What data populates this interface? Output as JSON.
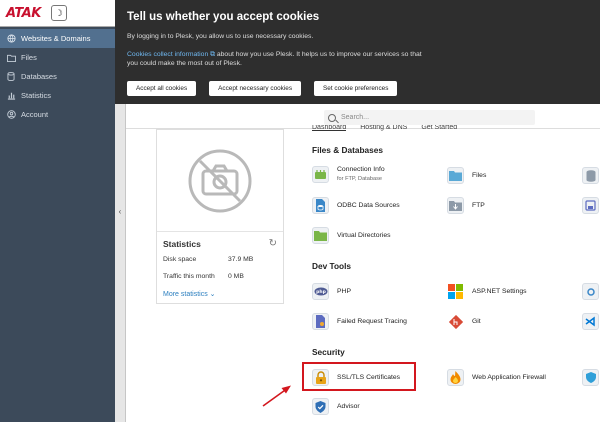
{
  "brand": {
    "logo_text": "ATAK",
    "seal_glyph": "☽"
  },
  "sidebar": {
    "items": [
      {
        "label": "Websites & Domains",
        "icon": "globe-icon",
        "active": true
      },
      {
        "label": "Files",
        "icon": "folder-icon",
        "active": false
      },
      {
        "label": "Databases",
        "icon": "database-icon",
        "active": false
      },
      {
        "label": "Statistics",
        "icon": "bar-chart-icon",
        "active": false
      },
      {
        "label": "Account",
        "icon": "user-icon",
        "active": false
      }
    ],
    "collapse_glyph": "‹"
  },
  "cookie": {
    "title": "Tell us whether you accept cookies",
    "line1": "By logging in to Plesk, you allow us to use necessary cookies.",
    "link": "Cookies collect information",
    "link_icon": "⧉",
    "line2_rest": " about how you use Plesk. It helps us to improve our services so that",
    "line3": "you could make the most out of Plesk.",
    "buttons": [
      "Accept all cookies",
      "Accept necessary cookies",
      "Set cookie preferences"
    ]
  },
  "search": {
    "placeholder": "Search..."
  },
  "tabs": [
    "Dashboard",
    "Hosting & DNS",
    "Get Started"
  ],
  "stats": {
    "title": "Statistics",
    "refresh_glyph": "↻",
    "disk_label": "Disk space",
    "disk_value": "37.9 MB",
    "traffic_label": "Traffic this month",
    "traffic_value": "0 MB",
    "more": "More statistics ⌄"
  },
  "sections": [
    {
      "title": "Files & Databases",
      "items": [
        {
          "label": "Connection Info",
          "sub": "for FTP, Database",
          "icon": "connection-icon",
          "color": "#7ab648"
        },
        {
          "label": "Files",
          "icon": "folder-icon",
          "color": "#5aa9d6"
        },
        {
          "label": "ODBC Data Sources",
          "icon": "odbc-icon",
          "color": "#3a87c8"
        },
        {
          "label": "FTP",
          "icon": "ftp-folder-icon",
          "color": "#8d9aa8"
        },
        {
          "label": "Virtual Directories",
          "icon": "virtual-directory-icon",
          "color": "#7ab648"
        }
      ]
    },
    {
      "title": "Dev Tools",
      "items": [
        {
          "label": "PHP",
          "icon": "php-icon",
          "color": "#4f5b93"
        },
        {
          "label": "ASP.NET Settings",
          "icon": "aspnet-icon",
          "color": "#d83b01"
        },
        {
          "label": "Failed Request Tracing",
          "icon": "request-tracing-icon",
          "color": "#5c6bc0"
        },
        {
          "label": "Git",
          "icon": "git-icon",
          "color": "#d84a36"
        }
      ]
    },
    {
      "title": "Security",
      "items": [
        {
          "label": "SSL/TLS Certificates",
          "icon": "lock-certificate-icon",
          "color": "#e8a317"
        },
        {
          "label": "Web Application Firewall",
          "icon": "flame-icon",
          "color": "#f08a00"
        },
        {
          "label": "Advisor",
          "icon": "advisor-icon",
          "color": "#2f6fb5"
        }
      ]
    }
  ]
}
